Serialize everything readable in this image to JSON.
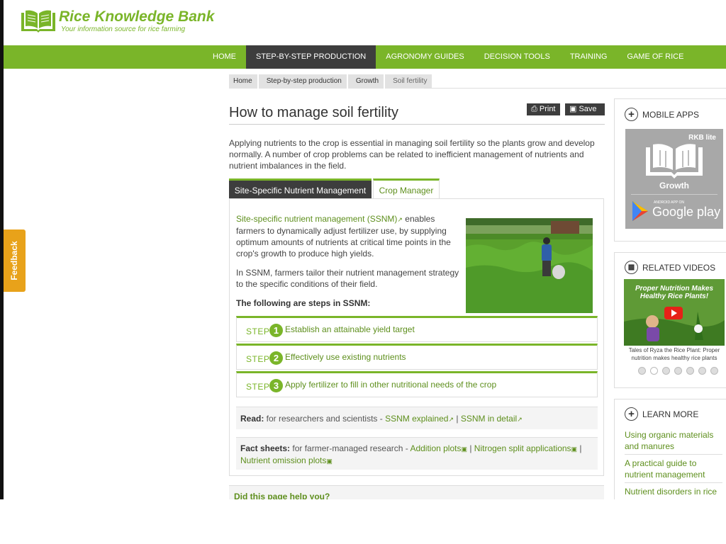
{
  "site": {
    "name": "Rice Knowledge Bank",
    "tagline": "Your information source for rice farming"
  },
  "nav": {
    "items": [
      "HOME",
      "STEP-BY-STEP PRODUCTION",
      "AGRONOMY GUIDES",
      "DECISION TOOLS",
      "TRAINING",
      "GAME OF RICE"
    ],
    "active": "STEP-BY-STEP PRODUCTION"
  },
  "breadcrumb": [
    "Home",
    "Step-by-step production",
    "Growth",
    "Soil fertility"
  ],
  "page": {
    "title": "How to manage soil fertility",
    "print_label": "Print",
    "save_label": "Save",
    "intro": "Applying nutrients to the crop is essential in managing soil fertility so the plants grow and develop normally. A number of crop problems can be related to inefficient management of nutrients and nutrient imbalances in the field."
  },
  "tabs": [
    {
      "label": "Site-Specific Nutrient Management",
      "active": true
    },
    {
      "label": "Crop Manager",
      "active": false
    }
  ],
  "ssnm": {
    "link_text": "Site-specific nutrient management (SSNM)",
    "para1_rest": " enables farmers to dynamically adjust fertilizer use, by supplying optimum amounts of nutrients at critical time points in the crop's growth to produce high yields.",
    "para2": "In SSNM, farmers tailor their nutrient management strategy to the specific conditions of their field.",
    "steps_heading": "The following are steps in SSNM:",
    "step_word": "STEP",
    "steps": [
      {
        "number": "1",
        "text": "Establish an attainable yield target"
      },
      {
        "number": "2",
        "text": "Effectively use existing nutrients"
      },
      {
        "number": "3",
        "text": "Apply fertilizer to fill in other nutritional needs of the crop"
      }
    ],
    "read": {
      "label": "Read:",
      "text": " for researchers and scientists - ",
      "link1": "SSNM explained",
      "sep": " | ",
      "link2": "SSNM in detail"
    },
    "factsheets": {
      "label": "Fact sheets:",
      "text": " for farmer-managed research - ",
      "link1": "Addition plots",
      "sep1": " | ",
      "link2": "Nitrogen split applications",
      "sep2": " | ",
      "link3": "Nutrient omission plots"
    },
    "help": "Did this page help you?"
  },
  "sidebar": {
    "mobile_apps": {
      "heading": "MOBILE APPS",
      "rkb_lite": "RKB lite",
      "growth": "Growth",
      "android": "ANDROID APP ON",
      "google_play": "Google play"
    },
    "related_videos": {
      "heading": "RELATED VIDEOS",
      "video_title": "Proper Nutrition Makes Healthy Rice Plants!",
      "caption": "Tales of Ryza the Rice Plant: Proper nutrition makes healthy rice plants",
      "dots": 7,
      "active_dot": 2
    },
    "learn_more": {
      "heading": "LEARN MORE",
      "links": [
        "Using organic materials and manures",
        "A practical guide to nutrient management",
        "Nutrient disorders in rice"
      ]
    }
  },
  "feedback": "Feedback",
  "colors": {
    "brand_green": "#7ab529",
    "link_green": "#5e8f1d",
    "dark": "#3d3d3d",
    "feedback_orange": "#e8a21a"
  }
}
